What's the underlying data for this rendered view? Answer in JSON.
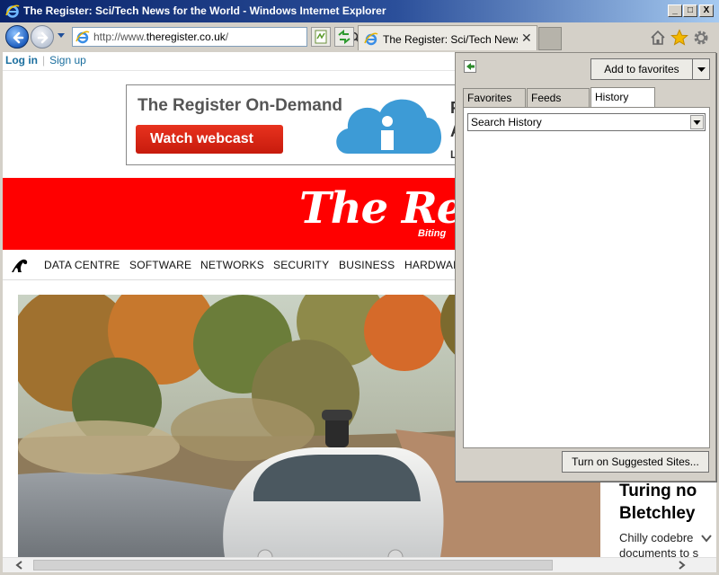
{
  "window": {
    "title": "The Register: Sci/Tech News for the World - Windows Internet Explorer",
    "controls": {
      "minimize": "_",
      "maximize": "□",
      "close": "X"
    }
  },
  "toolbar": {
    "address_prefix": "http://www.",
    "address_domain": "theregister.co.uk",
    "address_suffix": "/",
    "tab_title": "The Register: Sci/Tech News...",
    "tab_close": "✕"
  },
  "page": {
    "auth": {
      "login": "Log in",
      "signup": "Sign up"
    },
    "ad": {
      "title": "The Register On-Demand",
      "button": "Watch webcast",
      "side_lines": [
        "F",
        "A",
        "L"
      ]
    },
    "masthead": {
      "logo": "The Re",
      "tagline": "Biting"
    },
    "nav": [
      "DATA CENTRE",
      "SOFTWARE",
      "NETWORKS",
      "SECURITY",
      "BUSINESS",
      "HARDWARE"
    ],
    "story": {
      "headline_1": "Turing no",
      "headline_2": "Bletchley",
      "standfirst_1": "Chilly codebre",
      "standfirst_2": "documents to s"
    }
  },
  "favorites_center": {
    "add_button": "Add to favorites",
    "tabs": {
      "favorites": "Favorites",
      "feeds": "Feeds",
      "history": "History"
    },
    "active_tab": "history",
    "history_filter": "Search History",
    "suggested_button": "Turn on Suggested Sites..."
  },
  "colors": {
    "title_bar": "#0a246a",
    "masthead_red": "#ff0000",
    "ad_button_red": "#d9230f",
    "link_blue": "#1a6e9e"
  }
}
